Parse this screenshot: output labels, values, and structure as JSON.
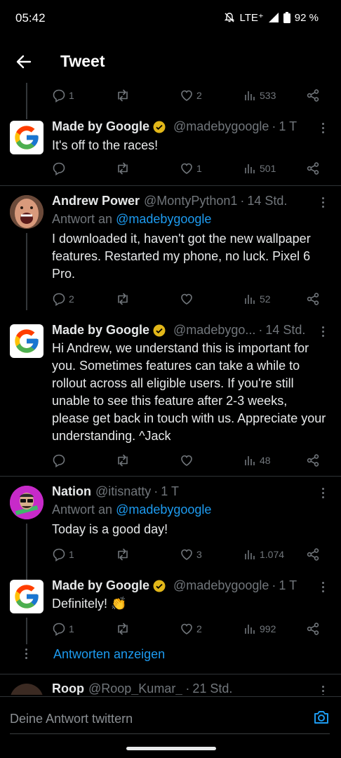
{
  "status_bar": {
    "time": "05:42",
    "network": "LTE⁺",
    "battery": "92 %"
  },
  "header": {
    "title": "Tweet"
  },
  "top_partial_actions": {
    "reply_count": "1",
    "like_count": "2",
    "views": "533"
  },
  "tweets": [
    {
      "name": "Made by Google",
      "verified": true,
      "handle": "@madebygoogle",
      "time": "1 T",
      "text": "It's off to the races!",
      "reply_count": "",
      "like_count": "1",
      "views": "501"
    },
    {
      "name": "Andrew Power",
      "verified": false,
      "handle": "@MontyPython1",
      "time": "14 Std.",
      "reply_label": "Antwort an",
      "reply_mention": "@madebygoogle",
      "text": "I downloaded it, haven't got the new wallpaper features. Restarted my phone, no luck. Pixel 6 Pro.",
      "reply_count": "2",
      "like_count": "",
      "views": "52"
    },
    {
      "name": "Made by Google",
      "verified": true,
      "handle": "@madebygo...",
      "time": "14 Std.",
      "text": "Hi Andrew, we understand this is important for you. Sometimes features can take a while to rollout across all eligible users. If you're still unable to see this feature after 2-3 weeks, please get back in touch with us. Appreciate your understanding. ^Jack",
      "reply_count": "",
      "like_count": "",
      "views": "48"
    },
    {
      "name": "Nation",
      "verified": false,
      "handle": "@itisnatty",
      "time": "1 T",
      "reply_label": "Antwort an",
      "reply_mention": "@madebygoogle",
      "text": "Today is a good day!",
      "reply_count": "1",
      "like_count": "3",
      "views": "1.074"
    },
    {
      "name": "Made by Google",
      "verified": true,
      "handle": "@madebygoogle",
      "time": "1 T",
      "text": "Definitely! 👏",
      "reply_count": "1",
      "like_count": "2",
      "views": "992"
    },
    {
      "name": "Roop",
      "verified": false,
      "handle": "@Roop_Kumar_",
      "time": "21 Std."
    }
  ],
  "show_replies_label": "Antworten anzeigen",
  "composer": {
    "placeholder": "Deine Antwort twittern"
  },
  "colors": {
    "background": "#000000",
    "text": "#e7e9ea",
    "muted": "#71767b",
    "link": "#1d9bf0",
    "verified_gold": "#e2b719",
    "divider": "#2f3336"
  },
  "icons": [
    "back-arrow-icon",
    "reply-icon",
    "retweet-icon",
    "like-icon",
    "views-icon",
    "share-icon",
    "more-icon",
    "verified-badge-icon",
    "camera-icon",
    "google-logo-icon"
  ]
}
